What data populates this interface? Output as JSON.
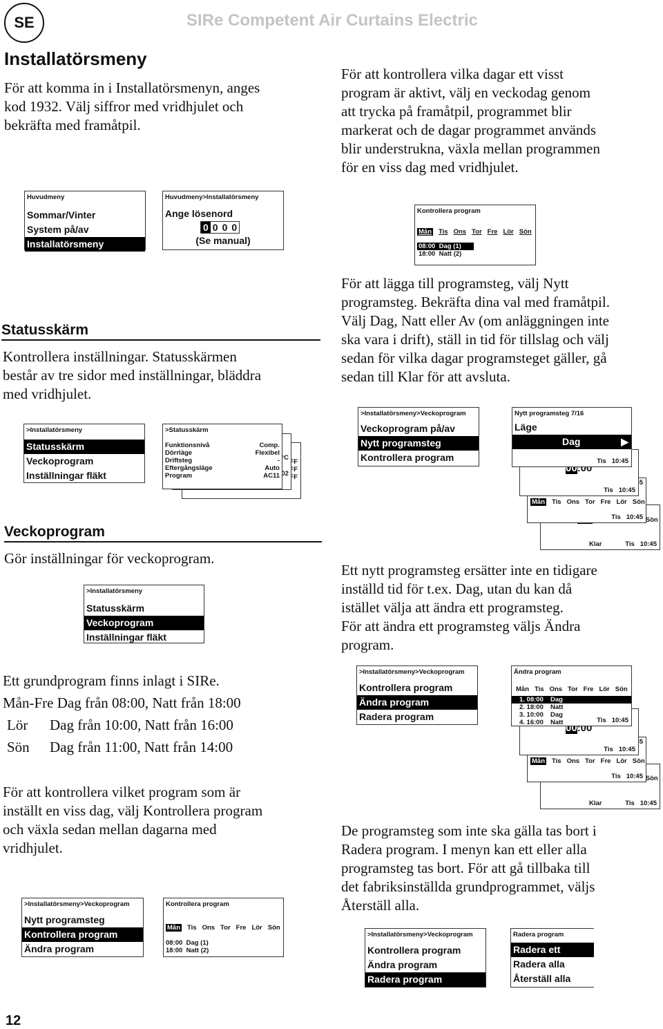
{
  "header": {
    "lang_badge": "SE",
    "doc_title": "SIRe Competent Air Curtains Electric",
    "page_number": "12"
  },
  "installer_menu": {
    "title": "Installatörsmeny",
    "intro": "För att komma in i Installatörsmenyn, anges\nkod 1932. Välj siffror med vridhjulet och\nbekräfta med framåtpil.",
    "check_days_text": "För att kontrollera vilka dagar ett visst\nprogram är aktivt, välj en veckodag genom\natt trycka på framåtpil, programmet blir\nmarkerat och de dagar programmet används\nblir understrukna, växla mellan programmen\nför en viss dag med vridhjulet.",
    "main_menu_screen": {
      "header": "Huvudmeny",
      "items": [
        "Sommar/Vinter",
        "System på/av",
        "Installatörsmeny"
      ],
      "selected": 2
    },
    "password_screen": {
      "header": "Huvudmeny>Installatörsmeny",
      "label": "Ange lösenord",
      "digits": [
        "0",
        "0",
        "0",
        "0"
      ],
      "active_digit": 0,
      "hint": "(Se manual)"
    },
    "check_program_screen": {
      "header": "Kontrollera program",
      "days": [
        "Mån",
        "Tis",
        "Ons",
        "Tor",
        "Fre",
        "Lör",
        "Sön"
      ],
      "selected_day": 0,
      "entries": [
        {
          "time": "08:00",
          "label": "Dag (1)",
          "highlight": true
        },
        {
          "time": "18:00",
          "label": "Natt (2)",
          "highlight": false
        }
      ]
    }
  },
  "status_section": {
    "title": "Statusskärm",
    "text": "Kontrollera inställningar. Statusskärmen\nbestår av tre sidor med inställningar, bläddra\nmed vridhjulet.",
    "menu_screen": {
      "header": ">Installatörsmeny",
      "items": [
        "Statusskärm",
        "Veckoprogram",
        "Inställningar fläkt"
      ],
      "selected": 0
    },
    "status_screen": {
      "header": ">Statusskärm",
      "rows": [
        {
          "label": "Funktionsnivå",
          "value": "Comp."
        },
        {
          "label": "Dörrläge",
          "value": "Flexibel"
        },
        {
          "label": "Driftsteg",
          "value": "-"
        },
        {
          "label": "Eftergångsläge",
          "value": "Auto"
        },
        {
          "label": "Program",
          "value": "AC11"
        }
      ],
      "back_page_fragments": [
        "°C",
        "FF",
        "FF",
        "02",
        "FF"
      ]
    }
  },
  "new_step": {
    "text": "För att lägga till programsteg, välj Nytt\nprogramsteg. Bekräfta dina val med framåtpil.\nVälj Dag, Natt eller Av (om anläggningen inte\nska vara i drift), ställ in tid för tillslag och välj\nsedan för vilka dagar programsteget gäller, gå\nsedan till Klar för att avsluta.",
    "menu_screen": {
      "header": ">Installatörsmeny>Veckoprogram",
      "items": [
        "Veckoprogram på/av",
        "Nytt programsteg",
        "Kontrollera program"
      ],
      "selected": 1
    },
    "step_screens": {
      "header": "Nytt programsteg 7/16",
      "mode_label": "Läge",
      "mode_value": "Dag",
      "arrow": "▶",
      "status_day": "Tis",
      "status_time": "10:45",
      "time_value_hours": "00",
      "time_value_minutes": ":00",
      "days": [
        "Mån",
        "Tis",
        "Ons",
        "Tor",
        "Fre",
        "Lör",
        "Sön"
      ],
      "done_label": "Klar"
    },
    "note": "Ett nytt programsteg ersätter inte en tidigare\ninställd tid för t.ex. Dag, utan du kan då\nistället välja att ändra ett programsteg.\nFör att ändra ett programsteg väljs Ändra\nprogram."
  },
  "weekly_section": {
    "title": "Veckoprogram",
    "text": "Gör inställningar för veckoprogram.",
    "menu_screen": {
      "header": ">Installatörsmeny",
      "items": [
        "Statusskärm",
        "Veckoprogram",
        "Inställningar fläkt"
      ],
      "selected": 1
    },
    "default_intro": "Ett grundprogram finns inlagt i SIRe.",
    "default_rows": [
      {
        "days": "Mån-Fre",
        "text": "Dag från 08:00, Natt från 18:00"
      },
      {
        "days": "Lör",
        "text": "Dag från 10:00, Natt från 16:00"
      },
      {
        "days": "Sön",
        "text": "Dag från 11:00, Natt från 14:00"
      }
    ],
    "check_text": "För att kontrollera vilket program som är\ninställt en viss dag, välj Kontrollera program\noch växla sedan mellan dagarna med\nvridhjulet.",
    "check_menu_screen": {
      "header": ">Installatörsmeny>Veckoprogram",
      "items": [
        "Nytt programsteg",
        "Kontrollera program",
        "Ändra program"
      ],
      "selected": 1
    },
    "check_program_screen": {
      "header": "Kontrollera program",
      "days": [
        "Mån",
        "Tis",
        "Ons",
        "Tor",
        "Fre",
        "Lör",
        "Sön"
      ],
      "entries": [
        {
          "time": "08:00",
          "label": "Dag (1)"
        },
        {
          "time": "18:00",
          "label": "Natt (2)"
        }
      ]
    }
  },
  "edit_section": {
    "menu_screen": {
      "header": ">Installatörsmeny>Veckoprogram",
      "items": [
        "Kontrollera program",
        "Ändra program",
        "Radera program"
      ],
      "selected": 1
    },
    "edit_screen": {
      "header": "Ändra program",
      "days": [
        "Mån",
        "Tis",
        "Ons",
        "Tor",
        "Fre",
        "Lör",
        "Sön"
      ],
      "entries": [
        {
          "n": "1. 08:00",
          "mode": "Dag"
        },
        {
          "n": "2. 18:00",
          "mode": "Natt"
        },
        {
          "n": "3. 10:00",
          "mode": "Dag"
        },
        {
          "n": "4. 16:00",
          "mode": "Natt"
        }
      ],
      "status_day": "Tis",
      "status_time": "10:45"
    },
    "delete_text": "De programsteg som inte ska gälla tas bort i\nRadera program. I menyn kan ett eller alla\nprogramsteg tas bort. För att gå tillbaka till\ndet fabriksinställda grundprogrammet, väljs\nÅterställ alla.",
    "delete_menu_screen": {
      "header": ">Installatörsmeny>Veckoprogram",
      "items": [
        "Kontrollera program",
        "Ändra program",
        "Radera program"
      ],
      "selected": 2
    },
    "delete_screen": {
      "header": "Radera program",
      "items": [
        "Radera ett",
        "Radera alla",
        "Återställ alla"
      ],
      "selected": 0
    }
  }
}
